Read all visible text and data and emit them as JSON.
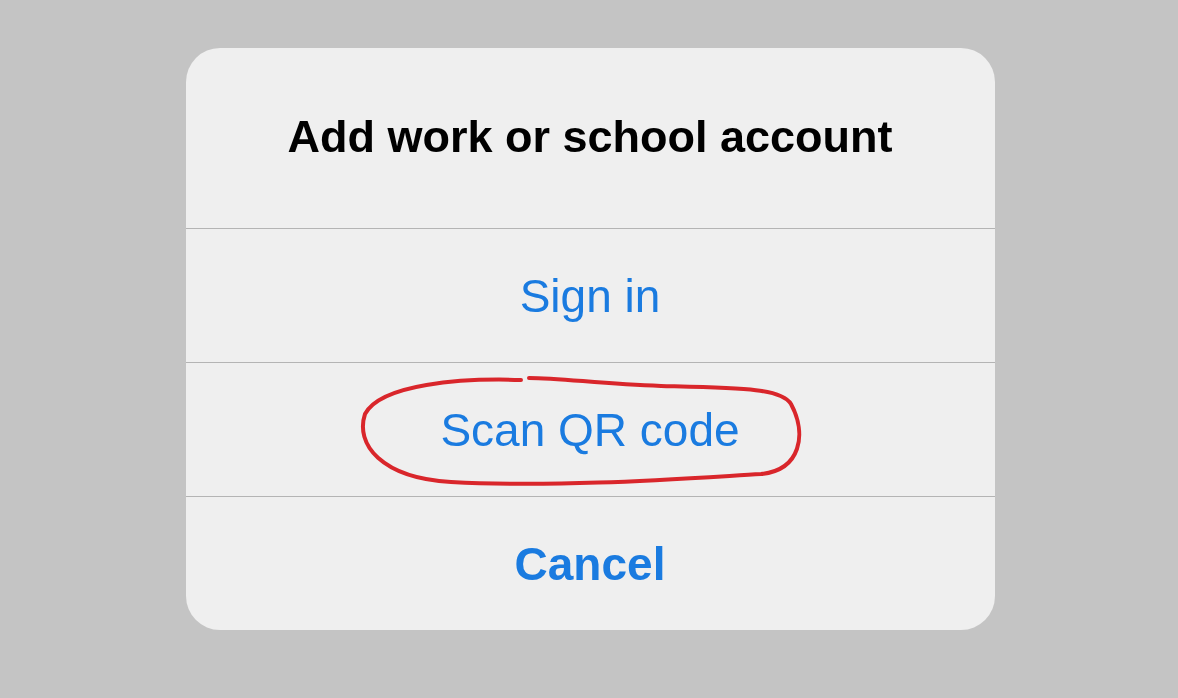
{
  "alert": {
    "title": "Add work or school account",
    "actions": [
      {
        "label": "Sign in",
        "kind": "default",
        "circled": false
      },
      {
        "label": "Scan QR code",
        "kind": "default",
        "circled": true
      },
      {
        "label": "Cancel",
        "kind": "cancel",
        "circled": false
      }
    ]
  }
}
